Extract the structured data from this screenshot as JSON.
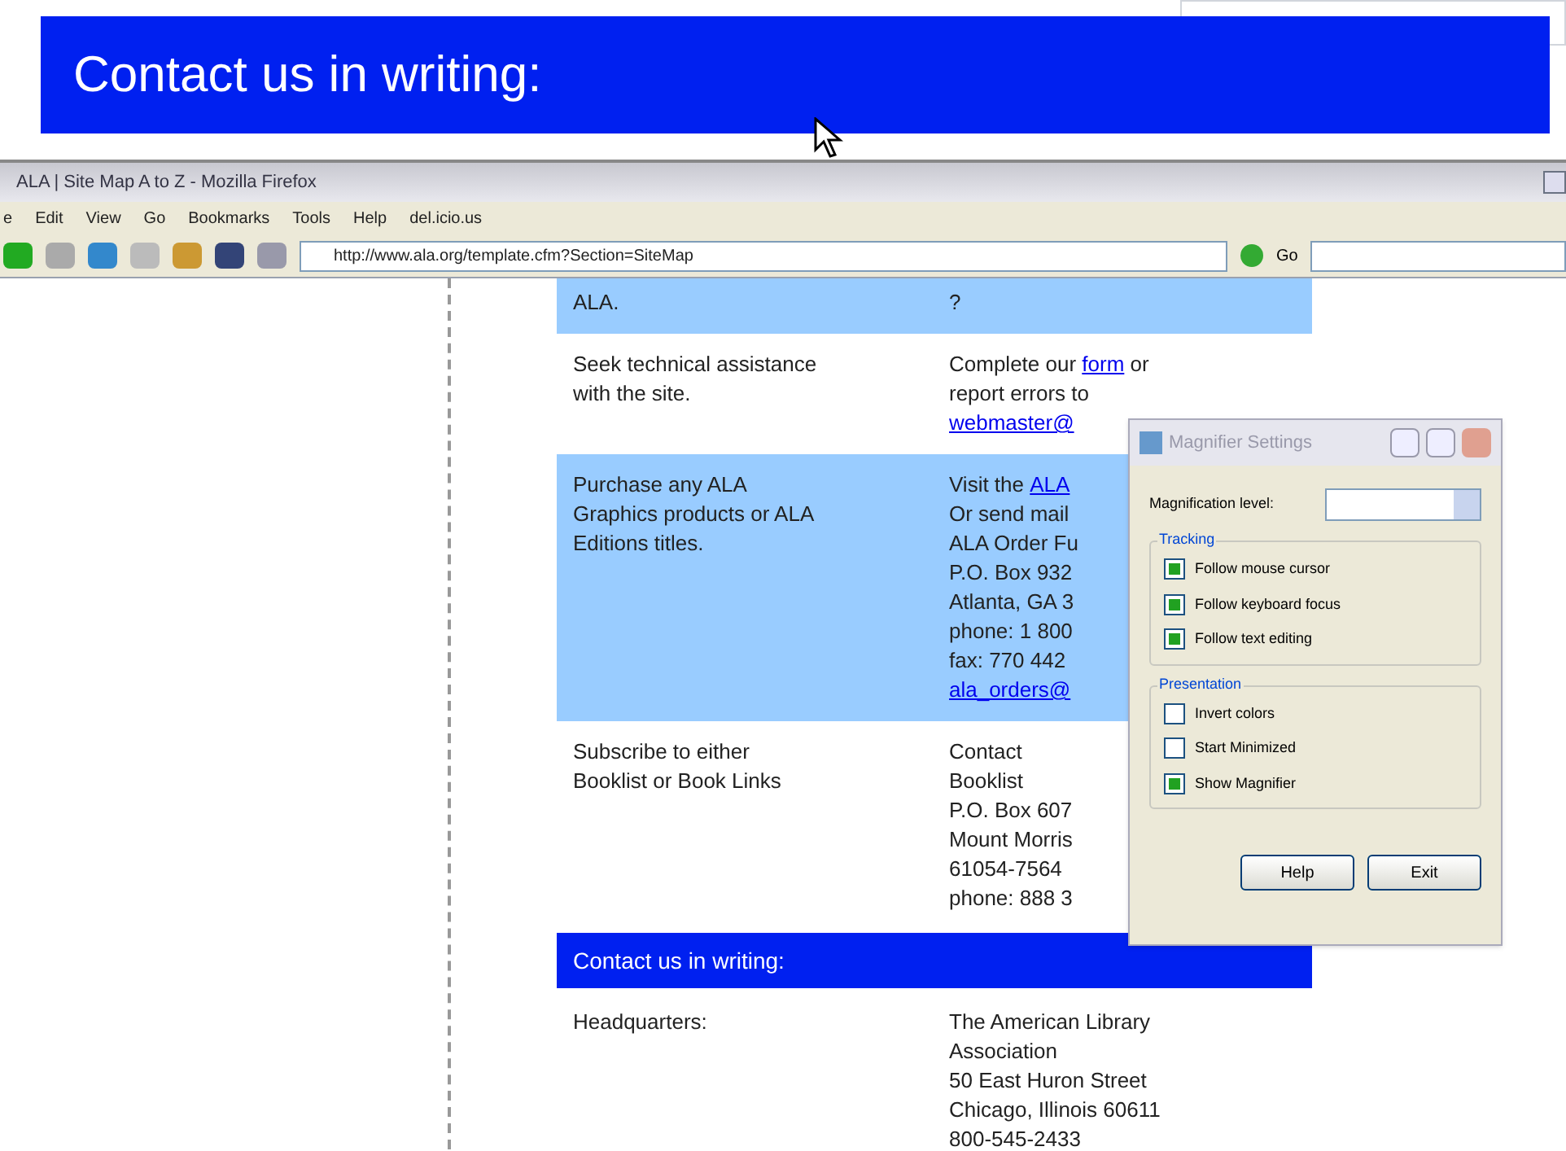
{
  "magnifier_view": {
    "heading": "Contact us in writing:"
  },
  "window": {
    "title": "ALA | Site Map A to Z - Mozilla Firefox"
  },
  "menu": [
    "e",
    "Edit",
    "View",
    "Go",
    "Bookmarks",
    "Tools",
    "Help",
    "del.icio.us"
  ],
  "address_bar": {
    "url": "http://www.ala.org/template.cfm?Section=SiteMap",
    "go": "Go"
  },
  "table": {
    "rows": [
      {
        "kind": "row",
        "shaded": true,
        "col1": [
          "ALA."
        ],
        "col2": [
          [
            {
              "t": "?"
            }
          ]
        ]
      },
      {
        "kind": "row",
        "shaded": false,
        "col1": [
          "Seek technical assistance",
          "with the site."
        ],
        "col2": [
          [
            {
              "t": "Complete our "
            },
            {
              "t": "form",
              "link": true
            },
            {
              "t": " or"
            }
          ],
          [
            {
              "t": "report errors to"
            }
          ],
          [
            {
              "t": "webmaster@",
              "link": true
            }
          ]
        ]
      },
      {
        "kind": "row",
        "shaded": true,
        "col1": [
          "Purchase any ALA",
          "Graphics products or ALA",
          "Editions titles."
        ],
        "col2": [
          [
            {
              "t": "Visit the "
            },
            {
              "t": "ALA",
              "link": true
            }
          ],
          [
            {
              "t": "Or send mail"
            }
          ],
          [
            {
              "t": "ALA Order Fu"
            }
          ],
          [
            {
              "t": "P.O. Box 932"
            }
          ],
          [
            {
              "t": "Atlanta, GA 3"
            }
          ],
          [
            {
              "t": "phone: 1 800"
            }
          ],
          [
            {
              "t": "fax: 770 442"
            }
          ],
          [
            {
              "t": "ala_orders@",
              "link": true
            }
          ]
        ]
      },
      {
        "kind": "row",
        "shaded": false,
        "col1": [
          "Subscribe to either",
          "Booklist or Book Links"
        ],
        "col2": [
          [
            {
              "t": "Contact"
            }
          ],
          [
            {
              "t": "Booklist"
            }
          ],
          [
            {
              "t": "P.O. Box 607"
            }
          ],
          [
            {
              "t": "Mount Morris"
            }
          ],
          [
            {
              "t": "61054-7564"
            }
          ],
          [
            {
              "t": "phone: 888 3"
            }
          ]
        ]
      },
      {
        "kind": "heading",
        "text": "Contact us in writing:"
      },
      {
        "kind": "row",
        "shaded": false,
        "col1": [
          "Headquarters:"
        ],
        "col2": [
          [
            {
              "t": "The American Library"
            }
          ],
          [
            {
              "t": "Association"
            }
          ],
          [
            {
              "t": "50 East Huron Street"
            }
          ],
          [
            {
              "t": "Chicago, Illinois 60611"
            }
          ],
          [
            {
              "t": "800-545-2433"
            }
          ]
        ]
      }
    ]
  },
  "dialog": {
    "title": "Magnifier Settings",
    "level_label": "Magnification level:",
    "groups": [
      {
        "title": "Tracking",
        "options": [
          {
            "label": "Follow mouse cursor",
            "checked": true
          },
          {
            "label": "Follow keyboard focus",
            "checked": true
          },
          {
            "label": "Follow text editing",
            "checked": true
          }
        ]
      },
      {
        "title": "Presentation",
        "options": [
          {
            "label": "Invert colors",
            "checked": false
          },
          {
            "label": "Start Minimized",
            "checked": false
          },
          {
            "label": "Show Magnifier",
            "checked": true
          }
        ]
      }
    ],
    "buttons": [
      "Help",
      "Exit"
    ]
  }
}
